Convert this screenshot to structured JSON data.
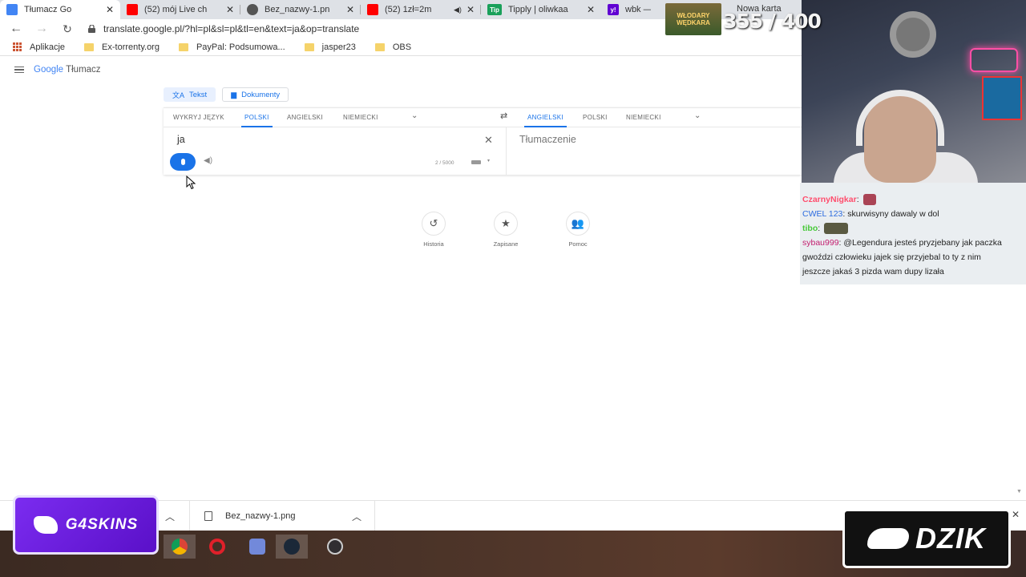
{
  "tabs": [
    {
      "title": "Tłumacz Go",
      "icon": "google-translate-icon",
      "color": "#4285f4",
      "active": true
    },
    {
      "title": "(52) mój Live ch",
      "icon": "youtube-icon",
      "color": "#ff0000"
    },
    {
      "title": "Bez_nazwy-1.pn",
      "icon": "globe-icon",
      "color": "#555555"
    },
    {
      "title": "(52) 1zł=2m",
      "icon": "youtube-icon",
      "color": "#ff0000"
    },
    {
      "title": "Tipply | oliwkaa",
      "icon": "tipply-icon",
      "color": "#1aa05a",
      "icon_text": "Tip"
    },
    {
      "title": "wbk —",
      "icon": "yahoo-icon",
      "color": "#6001d2",
      "icon_text": "y!"
    }
  ],
  "new_tab_label": "Nowa karta",
  "url": "translate.google.pl/?hl=pl&sl=pl&tl=en&text=ja&op=translate",
  "bookmarks": {
    "apps": "Aplikacje",
    "items": [
      "Ex-torrenty.org",
      "PayPal: Podsumowa...",
      "jasper23",
      "OBS"
    ]
  },
  "translate": {
    "logo_google": "Google",
    "logo_product": "Tłumacz",
    "mode_text": "Tekst",
    "mode_docs": "Dokumenty",
    "source_langs": [
      "WYKRYJ JĘZYK",
      "POLSKI",
      "ANGIELSKI",
      "NIEMIECKI"
    ],
    "target_langs": [
      "ANGIELSKI",
      "POLSKI",
      "NIEMIECKI"
    ],
    "source_text": "ja",
    "char_count": "2 / 5000",
    "target_placeholder": "Tłumaczenie",
    "quick": [
      {
        "label": "Historia",
        "icon": "history-icon"
      },
      {
        "label": "Zapisane",
        "icon": "star-icon"
      },
      {
        "label": "Pomoc",
        "icon": "contribute-icon"
      }
    ]
  },
  "download": {
    "filename": "Bez_nazwy-1.png"
  },
  "stream": {
    "goal_box_text": "WŁODARY WĘDKARA",
    "goal_counter": "355 / 400",
    "chat": [
      {
        "user": "CzarnyNigkar",
        "text": ""
      },
      {
        "user": "CWEL 123",
        "text": "skurwisyny dawaly w dol"
      },
      {
        "user": "tibo",
        "text": ""
      },
      {
        "user": "sybau999",
        "text": "@Legendura jesteś pryzjebany jak paczka gwoździ człowieku jajek się przyjebal to ty z nim"
      },
      {
        "user": "",
        "text": "jeszcze jakaś 3 pizda wam dupy lizała"
      }
    ],
    "sponsor_left": "G4SKINS",
    "sponsor_right": "DZIK"
  }
}
